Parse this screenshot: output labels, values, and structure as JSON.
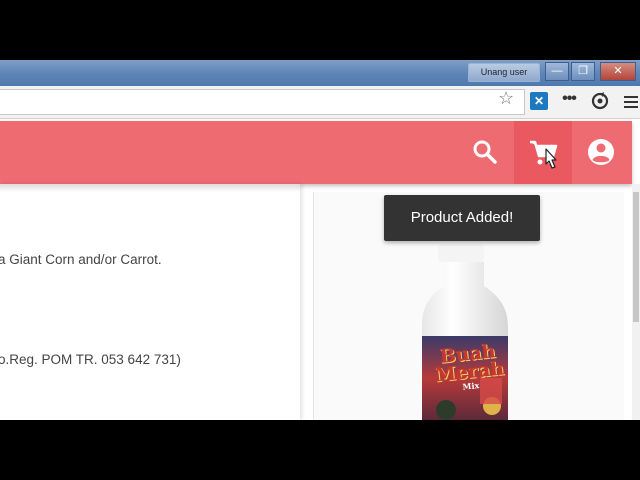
{
  "os": {
    "user_badge": "Unang user",
    "minimize": "—",
    "maximize": "❐",
    "close": "✕"
  },
  "browser": {
    "bookmark_star": "☆",
    "extension_x": "✕",
    "extension_dots": "•••"
  },
  "header": {
    "background": "#ee6b72",
    "icons": [
      "search-icon",
      "cart-icon",
      "account-icon"
    ]
  },
  "product": {
    "description_lines": [
      "a Giant Corn and/or Carrot.",
      "o.Reg. POM TR. 053 642 731)"
    ],
    "bottle_brand_line1": "Buah",
    "bottle_brand_line2": "Merah",
    "bottle_sub": "Mix"
  },
  "toast": {
    "message": "Product Added!"
  }
}
